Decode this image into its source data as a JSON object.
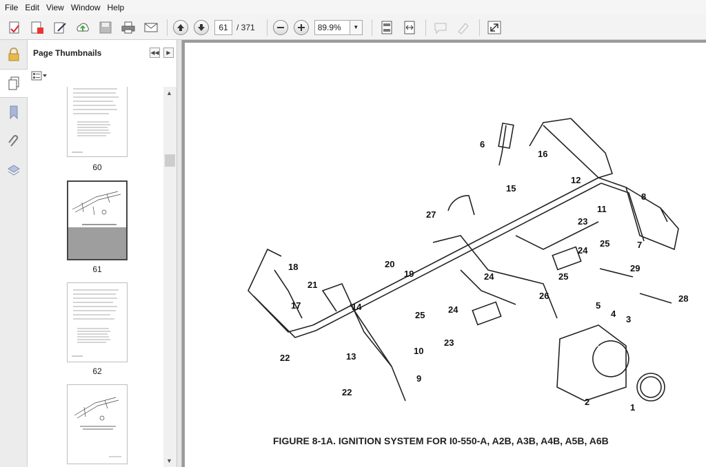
{
  "menu": [
    "File",
    "Edit",
    "View",
    "Window",
    "Help"
  ],
  "toolbar": {
    "page_current": "61",
    "page_total": "/ 371",
    "zoom": "89.9%",
    "icons": [
      "create-icon",
      "edit-pdf-icon",
      "sign-icon",
      "cloud-upload-icon",
      "save-icon",
      "print-icon",
      "email-icon",
      "page-up-icon",
      "page-down-icon",
      "zoom-out-icon",
      "zoom-in-icon",
      "fit-page-icon",
      "fit-width-icon",
      "comment-icon",
      "highlight-icon",
      "fullscreen-icon"
    ]
  },
  "sidebar": {
    "title": "Page Thumbnails",
    "rail_icons": [
      "lock-icon",
      "pages-icon",
      "bookmark-icon",
      "attachment-icon",
      "layers-icon"
    ],
    "thumbnails": [
      {
        "label": "60"
      },
      {
        "label": "61",
        "selected": true
      },
      {
        "label": "62"
      },
      {
        "label": ""
      }
    ]
  },
  "document": {
    "caption": "FIGURE 8-1A. IGNITION SYSTEM FOR I0-550-A, A2B, A3B, A4B, A5B, A6B",
    "callouts": [
      "1",
      "2",
      "3",
      "4",
      "5",
      "6",
      "7",
      "8",
      "9",
      "10",
      "11",
      "12",
      "13",
      "14",
      "15",
      "16",
      "17",
      "18",
      "19",
      "20",
      "21",
      "22",
      "22",
      "23",
      "23",
      "24",
      "24",
      "24",
      "25",
      "25",
      "25",
      "26",
      "27",
      "28",
      "29"
    ]
  }
}
